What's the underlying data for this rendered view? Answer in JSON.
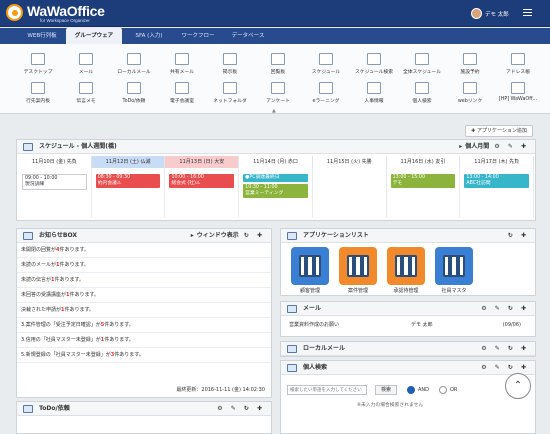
{
  "header": {
    "brand": "WaWaOffice",
    "brand_sub": "for Workspace Organizer",
    "user": "デモ 太郎"
  },
  "nav": {
    "tabs": [
      "WEB行列板",
      "グループウェア",
      "SFA (入力)",
      "ワークフロー",
      "データベース"
    ],
    "active": "グループウェア"
  },
  "apps": [
    {
      "label": "デスクトップ",
      "icon": "desktop-icon"
    },
    {
      "label": "メール",
      "icon": "mail-icon"
    },
    {
      "label": "ローカルメール",
      "icon": "local-mail-icon"
    },
    {
      "label": "共有メール",
      "icon": "shared-mail-icon"
    },
    {
      "label": "掲示板",
      "icon": "board-icon"
    },
    {
      "label": "回覧板",
      "icon": "circular-icon"
    },
    {
      "label": "スケジュール",
      "icon": "calendar-icon"
    },
    {
      "label": "スケジュール検索",
      "icon": "schedule-search-icon"
    },
    {
      "label": "全体スケジュール",
      "icon": "all-schedule-icon"
    },
    {
      "label": "施設予約",
      "icon": "facility-icon"
    },
    {
      "label": "アドレス帳",
      "icon": "address-book-icon"
    },
    {
      "label": "行先案内板",
      "icon": "destination-board-icon"
    },
    {
      "label": "伝言メモ",
      "icon": "memo-icon"
    },
    {
      "label": "ToDo/依頼",
      "icon": "todo-icon"
    },
    {
      "label": "電子会議室",
      "icon": "meeting-room-icon"
    },
    {
      "label": "ネットフォルダ",
      "icon": "folder-icon"
    },
    {
      "label": "アンケート",
      "icon": "survey-icon"
    },
    {
      "label": "eラーニング",
      "icon": "elearning-icon"
    },
    {
      "label": "人事情報",
      "icon": "hr-icon"
    },
    {
      "label": "個人検索",
      "icon": "person-search-icon"
    },
    {
      "label": "webリンク",
      "icon": "weblink-icon"
    },
    {
      "label": "[HP] WaWaOff...",
      "icon": "hp-icon"
    }
  ],
  "add_app_button": "アプリケーション追加",
  "schedule": {
    "title": "スケジュール - 個人週間(橋)",
    "mode": "個人月間",
    "days": [
      {
        "label": "11月10日 (金) 先負",
        "color": "#ffffff"
      },
      {
        "label": "11月12日 (土) 仏滅",
        "color": "#c9dcf5"
      },
      {
        "label": "11月13日 (日) 大安",
        "color": "#f8cccc"
      },
      {
        "label": "11月14日 (月) 赤口",
        "color": "#ffffff"
      },
      {
        "label": "11月15日 (火) 先勝",
        "color": "#ffffff"
      },
      {
        "label": "11月16日 (水) 友引",
        "color": "#ffffff"
      },
      {
        "label": "11月17日 (木) 先負",
        "color": "#ffffff"
      }
    ],
    "events": [
      {
        "day": 0,
        "time": "09:00 - 10:00",
        "text": "現況訓練",
        "style": "ev-gray"
      },
      {
        "day": 1,
        "time": "08:30 - 09:30",
        "text": "約内会議⚠",
        "style": "ev-red"
      },
      {
        "day": 2,
        "time": "10:00 - 16:00",
        "text": "総会式 (社)⚠",
        "style": "ev-red"
      },
      {
        "day": 3,
        "time": "",
        "text": "●PC調達最終日",
        "style": "ev-teal"
      },
      {
        "day": 3,
        "time": "10:30 - 11:00",
        "text": "営業ミーティング",
        "style": "ev-olive"
      },
      {
        "day": 5,
        "time": "13:00 - 15:00",
        "text": "デモ",
        "style": "ev-olive"
      },
      {
        "day": 6,
        "time": "13:00 - 14:00",
        "text": "ABC社訪問",
        "style": "ev-teal"
      }
    ]
  },
  "notice": {
    "title": "お知らせBOX",
    "window_label": "ウィンドウ表示",
    "lines": [
      {
        "pre": "未開閉の回覧が",
        "num": "4",
        "post": "件あります。"
      },
      {
        "pre": "未読のメールが",
        "num": "1",
        "post": "件あります。"
      },
      {
        "pre": "未読の伝言が",
        "num": "1",
        "post": "件あります。"
      },
      {
        "pre": "未回答の受講講座が",
        "num": "1",
        "post": "件あります。"
      },
      {
        "pre": "決裁された申請が",
        "num": "1",
        "post": "件あります。"
      },
      {
        "pre": "3.案件管理の「受注予定日確認」が",
        "num": "5",
        "post": "件あります。"
      },
      {
        "pre": "3.信用の「社員マスター未登録」が",
        "num": "1",
        "post": "件あります。"
      },
      {
        "pre": "5.新規登録の「社員マスター未登録」が",
        "num": "3",
        "post": "件あります。"
      }
    ],
    "updated": "最終更新：2016-11-11 (金) 14:02:30"
  },
  "todo": {
    "title": "ToDo/依頼"
  },
  "applist": {
    "title": "アプリケーションリスト",
    "items": [
      {
        "label": "顧客管理",
        "color": "#3b7fd4"
      },
      {
        "label": "案件管理",
        "color": "#f28a2c"
      },
      {
        "label": "承認待管理",
        "color": "#f28a2c"
      },
      {
        "label": "社員マスタ",
        "color": "#3b7fd4"
      }
    ]
  },
  "mail": {
    "title": "メール",
    "subject": "営業資料作成のお願い",
    "from": "デモ 太郎",
    "date": "(09/06)"
  },
  "localmail": {
    "title": "ローカルメール"
  },
  "personsearch": {
    "title": "個人検索",
    "placeholder": "検索したい単語を入力してください",
    "search_button": "検索",
    "and": "AND",
    "or": "OR",
    "note": "※未入力の場合検索されません"
  }
}
